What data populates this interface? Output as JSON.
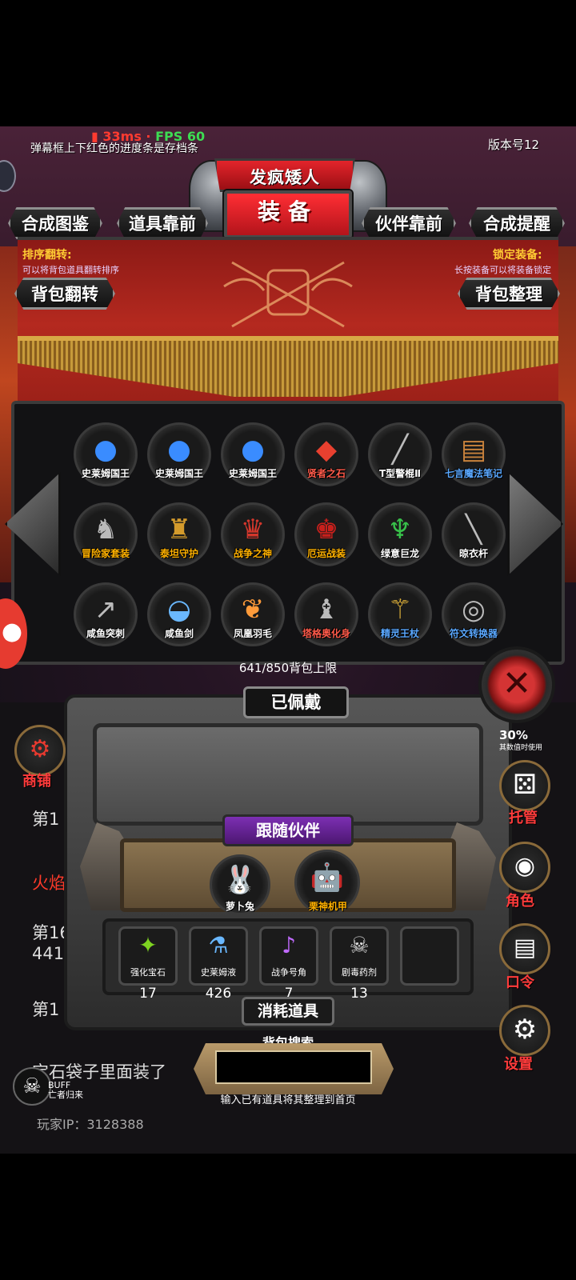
{
  "status": {
    "ping": "33ms",
    "fps": "FPS 60",
    "hint_top": "弹幕框上下红色的进度条是存档条",
    "version": "版本号12"
  },
  "header": {
    "player_name": "发疯矮人",
    "main_title": "装备"
  },
  "tabs": {
    "craft_guide": "合成图鉴",
    "items_first": "道具靠前",
    "partner_first": "伙伴靠前",
    "craft_remind": "合成提醒"
  },
  "banner": {
    "sort_title": "排序翻转:",
    "sort_sub": "可以将背包道具翻转排序",
    "lock_title": "锁定装备:",
    "lock_sub": "长按装备可以将装备锁定",
    "flip_button": "背包翻转",
    "tidy_button": "背包整理"
  },
  "inventory": {
    "items": [
      {
        "label": "史莱姆国王",
        "icon": "slime-icon",
        "color": "#ffffff"
      },
      {
        "label": "史莱姆国王",
        "icon": "slime-icon",
        "color": "#ffffff"
      },
      {
        "label": "史莱姆国王",
        "icon": "slime-icon",
        "color": "#ffffff"
      },
      {
        "label": "贤者之石",
        "icon": "gem-icon",
        "color": "#ff5a4a"
      },
      {
        "label": "T型警棍Ⅱ",
        "icon": "baton-icon",
        "color": "#ffffff"
      },
      {
        "label": "七言魔法笔记",
        "icon": "book-icon",
        "color": "#5aa8ff"
      },
      {
        "label": "冒险家套装",
        "icon": "adventurer-icon",
        "color": "#ffb100"
      },
      {
        "label": "泰坦守护",
        "icon": "titan-icon",
        "color": "#ffb100"
      },
      {
        "label": "战争之神",
        "icon": "war-god-icon",
        "color": "#ffb100"
      },
      {
        "label": "厄运战装",
        "icon": "doom-armor-icon",
        "color": "#ffb100"
      },
      {
        "label": "绿意巨龙",
        "icon": "dragon-icon",
        "color": "#ffffff"
      },
      {
        "label": "晾衣杆",
        "icon": "pole-icon",
        "color": "#ffffff"
      },
      {
        "label": "咸鱼突刺",
        "icon": "spear-icon",
        "color": "#ffffff"
      },
      {
        "label": "咸鱼剑",
        "icon": "fish-icon",
        "color": "#ffffff"
      },
      {
        "label": "凤凰羽毛",
        "icon": "feather-icon",
        "color": "#ffffff"
      },
      {
        "label": "塔格奥化身",
        "icon": "tago-icon",
        "color": "#ff5a4a"
      },
      {
        "label": "精灵王杖",
        "icon": "scepter-icon",
        "color": "#5aa8ff"
      },
      {
        "label": "符文转换器",
        "icon": "rune-converter-icon",
        "color": "#5aa8ff"
      }
    ],
    "capacity": "641/850背包上限"
  },
  "equipped": {
    "title": "已佩戴"
  },
  "companions": {
    "title": "跟随伙伴",
    "list": [
      {
        "label": "萝卜兔",
        "color": "#ffffff"
      },
      {
        "label": "栗神机甲",
        "color": "#ffb100"
      }
    ]
  },
  "consumables": {
    "title": "消耗道具",
    "items": [
      {
        "label": "强化宝石",
        "count": "17"
      },
      {
        "label": "史莱姆液",
        "count": "426"
      },
      {
        "label": "战争号角",
        "count": "7"
      },
      {
        "label": "剧毒药剂",
        "count": "13"
      }
    ]
  },
  "search": {
    "title": "背包搜索",
    "placeholder": "",
    "hint": "输入已有道具将其整理到首页"
  },
  "side": {
    "shop": "商铺",
    "manage": "托管",
    "role": "角色",
    "command": "口令",
    "settings": "设置",
    "pct": "30%",
    "pct_sub": "其数值时使用"
  },
  "background_log": {
    "line1": "第1",
    "line2": "火焰",
    "line3": "第16",
    "line4": "441",
    "line5": "第1",
    "line6": "宝石袋子里面装了",
    "player_ip": "玩家IP：3128388",
    "buff": "BUFF",
    "buff_sub": "亡者归来"
  }
}
